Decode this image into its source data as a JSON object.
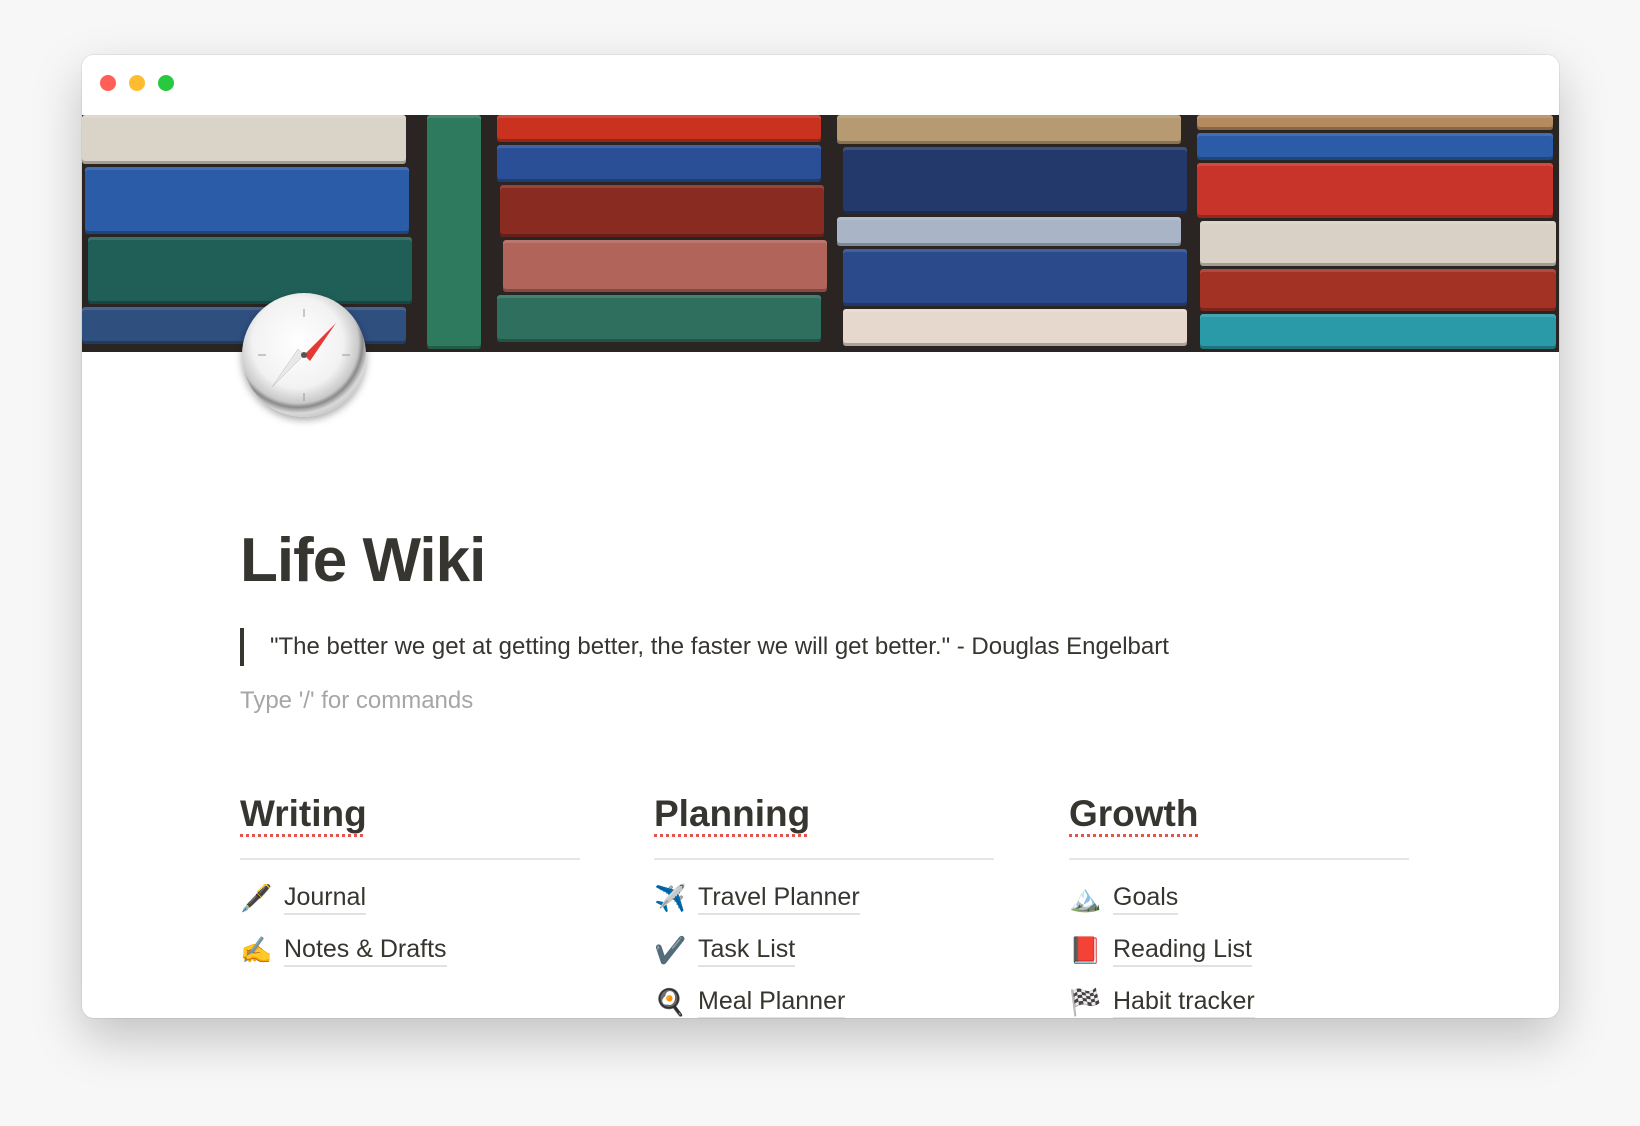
{
  "window": {
    "controls": [
      "close",
      "minimize",
      "zoom"
    ],
    "colors": {
      "close": "#ff5f57",
      "minimize": "#febc2e",
      "zoom": "#28c840"
    }
  },
  "page": {
    "icon": "compass-icon",
    "title": "Life Wiki",
    "quote": "\"The better we get at getting better, the faster we will get better.\" - Douglas Engelbart",
    "placeholder": "Type '/' for commands"
  },
  "columns": [
    {
      "heading": "Writing",
      "items": [
        {
          "icon": "fountain-pen-icon",
          "emoji": "🖋️",
          "label": "Journal"
        },
        {
          "icon": "writing-hand-icon",
          "emoji": "✍️",
          "label": "Notes & Drafts"
        }
      ]
    },
    {
      "heading": "Planning",
      "items": [
        {
          "icon": "airplane-icon",
          "emoji": "✈️",
          "label": "Travel Planner"
        },
        {
          "icon": "check-mark-icon",
          "emoji": "✔️",
          "label": "Task List"
        },
        {
          "icon": "frying-pan-icon",
          "emoji": "🍳",
          "label": "Meal Planner"
        }
      ]
    },
    {
      "heading": "Growth",
      "items": [
        {
          "icon": "mountain-icon",
          "emoji": "🏔️",
          "label": "Goals"
        },
        {
          "icon": "red-book-icon",
          "emoji": "📕",
          "label": "Reading List"
        },
        {
          "icon": "checkered-flag-icon",
          "emoji": "🏁",
          "label": "Habit tracker"
        }
      ]
    }
  ]
}
